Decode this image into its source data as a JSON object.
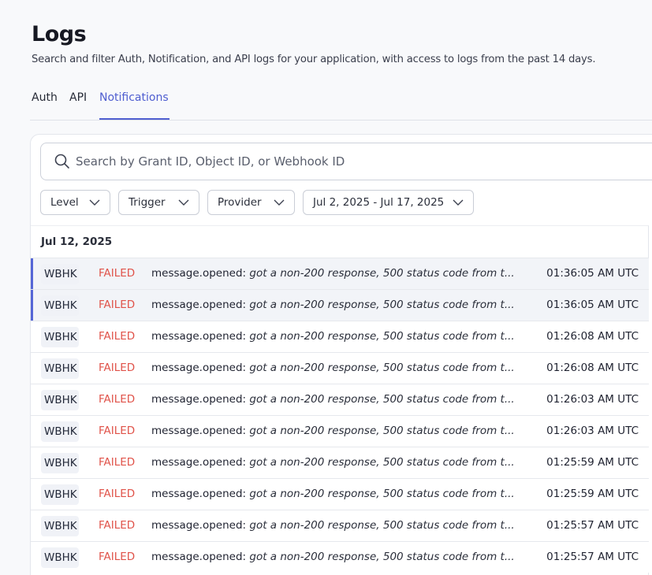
{
  "header": {
    "title": "Logs",
    "subtitle": "Search and filter Auth, Notification, and API logs for your application, with access to logs from the past 14 days."
  },
  "tabs": [
    {
      "label": "Auth"
    },
    {
      "label": "API"
    },
    {
      "label": "Notifications",
      "active": true
    }
  ],
  "search": {
    "placeholder": "Search by Grant ID, Object ID, or Webhook ID",
    "value": ""
  },
  "filters": {
    "level": "Level",
    "trigger": "Trigger",
    "provider": "Provider",
    "date_range": "Jul 2, 2025 - Jul 17, 2025"
  },
  "log_list": {
    "date_header": "Jul 12, 2025",
    "rows": [
      {
        "type": "WBHK",
        "status": "FAILED",
        "event": "message.opened:",
        "detail": "got a non-200 response, 500 status code from t...",
        "time": "01:36:05 AM UTC",
        "highlighted": true
      },
      {
        "type": "WBHK",
        "status": "FAILED",
        "event": "message.opened:",
        "detail": "got a non-200 response, 500 status code from t...",
        "time": "01:36:05 AM UTC",
        "highlighted": true
      },
      {
        "type": "WBHK",
        "status": "FAILED",
        "event": "message.opened:",
        "detail": "got a non-200 response, 500 status code from t...",
        "time": "01:26:08 AM UTC",
        "highlighted": false
      },
      {
        "type": "WBHK",
        "status": "FAILED",
        "event": "message.opened:",
        "detail": "got a non-200 response, 500 status code from t...",
        "time": "01:26:08 AM UTC",
        "highlighted": false
      },
      {
        "type": "WBHK",
        "status": "FAILED",
        "event": "message.opened:",
        "detail": "got a non-200 response, 500 status code from t...",
        "time": "01:26:03 AM UTC",
        "highlighted": false
      },
      {
        "type": "WBHK",
        "status": "FAILED",
        "event": "message.opened:",
        "detail": "got a non-200 response, 500 status code from t...",
        "time": "01:26:03 AM UTC",
        "highlighted": false
      },
      {
        "type": "WBHK",
        "status": "FAILED",
        "event": "message.opened:",
        "detail": "got a non-200 response, 500 status code from t...",
        "time": "01:25:59 AM UTC",
        "highlighted": false
      },
      {
        "type": "WBHK",
        "status": "FAILED",
        "event": "message.opened:",
        "detail": "got a non-200 response, 500 status code from t...",
        "time": "01:25:59 AM UTC",
        "highlighted": false
      },
      {
        "type": "WBHK",
        "status": "FAILED",
        "event": "message.opened:",
        "detail": "got a non-200 response, 500 status code from t...",
        "time": "01:25:57 AM UTC",
        "highlighted": false
      },
      {
        "type": "WBHK",
        "status": "FAILED",
        "event": "message.opened:",
        "detail": "got a non-200 response, 500 status code from t...",
        "time": "01:25:57 AM UTC",
        "highlighted": false
      }
    ]
  },
  "icons": {
    "search": "search-icon",
    "dropdown": "chevron-down-icon"
  },
  "colors": {
    "accent": "#4f5ed0",
    "failed": "#e0534a",
    "highlight_bar": "#5566d6"
  }
}
